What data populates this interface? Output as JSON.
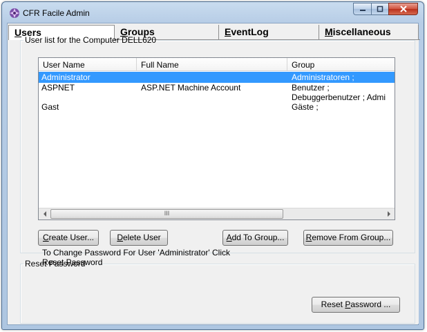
{
  "window": {
    "title": "CFR Facile Admin"
  },
  "tabs": [
    {
      "label_ul": "U",
      "label_rest": "sers",
      "selected": true
    },
    {
      "label_ul": "G",
      "label_rest": "roups",
      "selected": false
    },
    {
      "label_ul": "E",
      "label_rest": "ventLog",
      "selected": false
    },
    {
      "label_ul": "M",
      "label_rest": "iscellaneous",
      "selected": false
    }
  ],
  "user_list": {
    "legend": "User list for the Computer DELL620",
    "columns": [
      "User Name",
      "Full Name",
      "Group"
    ],
    "rows": [
      {
        "user": "Administrator",
        "full": "",
        "group": "Administratoren ;",
        "selected": true
      },
      {
        "user": "ASPNET",
        "full": "ASP.NET Machine Account",
        "group": "Benutzer ;",
        "selected": false
      },
      {
        "user": "",
        "full": "",
        "group": "Debuggerbenutzer ; Admi",
        "selected": false
      },
      {
        "user": "Gast",
        "full": "",
        "group": "Gäste ;",
        "selected": false
      }
    ],
    "scroll_thumb_glyph": "III",
    "buttons": {
      "create": {
        "ul": "C",
        "rest": "reate User..."
      },
      "delete": {
        "ul": "D",
        "rest": "elete User"
      },
      "add_group": {
        "pre": "",
        "ul": "A",
        "rest": "dd To Group..."
      },
      "remove_group": {
        "ul": "R",
        "rest": "emove From Group..."
      }
    }
  },
  "reset_password": {
    "legend": "Reset Password",
    "info": "To Change Password For User 'Administrator' Click Reset Password",
    "button": {
      "pre": "Reset ",
      "ul": "P",
      "rest": "assword ..."
    }
  },
  "colors": {
    "selection": "#3399ff",
    "titlebar": "#c9dcef",
    "close_button": "#d0533e"
  }
}
